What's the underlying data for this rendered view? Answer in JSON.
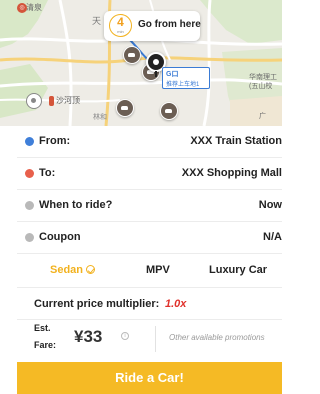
{
  "map": {
    "label_top": "清泉",
    "label_tian": "天",
    "label_shahe": "沙河顶",
    "label_linhe": "林和",
    "label_huanan_line1": "华南理工",
    "label_huanan_line2": "(五山校",
    "label_guang": "广",
    "go_chip": {
      "minutes": "4",
      "unit": "min",
      "text": "Go from here"
    },
    "pickup": {
      "title": "G口",
      "subtitle": "推荐上车地1"
    }
  },
  "form": {
    "from": {
      "label": "From:",
      "value": "XXX Train Station"
    },
    "to": {
      "label": "To:",
      "value": "XXX Shopping Mall"
    },
    "when": {
      "label": "When to ride?",
      "value": "Now"
    },
    "coupon": {
      "label": "Coupon",
      "value": "N/A"
    }
  },
  "car_types": {
    "sedan": "Sedan",
    "mpv": "MPV",
    "luxury": "Luxury Car",
    "selected": "Sedan"
  },
  "multiplier": {
    "label": "Current price multiplier:",
    "value": "1.0x"
  },
  "fare": {
    "est_label": "Est.",
    "fare_label": "Fare:",
    "price": "¥33",
    "info_icon": "i",
    "promo": "Other available promotions"
  },
  "ride_button": "Ride a Car!",
  "colors": {
    "accent": "#f5ba25",
    "from_icon": "#3f7fd9",
    "to_icon": "#e8604c",
    "multiplier": "#e0312b"
  }
}
